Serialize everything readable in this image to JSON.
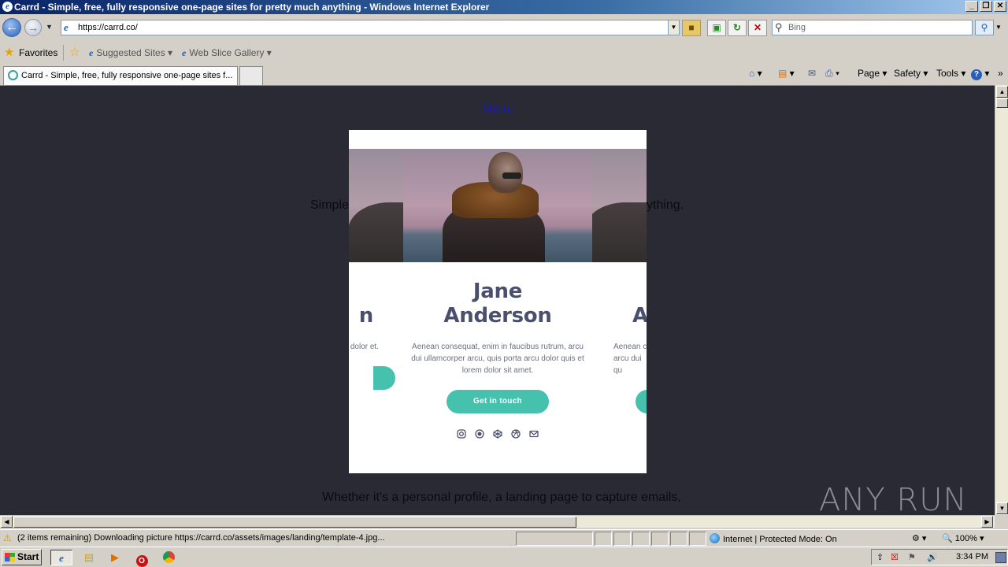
{
  "window": {
    "title": "Carrd - Simple, free, fully responsive one-page sites for pretty much anything - Windows Internet Explorer",
    "controls": [
      "_",
      "❐",
      "✕"
    ]
  },
  "nav": {
    "url": "https://carrd.co/",
    "search_placeholder": "Bing"
  },
  "favorites": {
    "label": "Favorites",
    "links": [
      "Suggested Sites ▾",
      "Web Slice Gallery ▾"
    ]
  },
  "tab": {
    "title": "Carrd - Simple, free, fully responsive one-page sites f..."
  },
  "commands": {
    "page": "Page ▾",
    "safety": "Safety ▾",
    "tools": "Tools ▾"
  },
  "page": {
    "menu_link": "Menu",
    "tagline_left": "Simple",
    "tagline_right": "ything.",
    "footer_line": "Whether it's a personal profile, a landing page to capture emails,"
  },
  "card": {
    "name_line1": "Jane",
    "name_line2": "Anderson",
    "bio": "Aenean consequat, enim in faucibus rutrum, arcu dui ullamcorper arcu, quis porta arcu dolor quis et lorem dolor sit amet.",
    "cta": "Get in touch",
    "left_name_fragment": "n",
    "left_bio_fragment": "us rutrum, a arcu dolor et.",
    "right_name_fragment": "A",
    "right_bio_fragment": "Aenean c arcu dui qu"
  },
  "status": {
    "text": "(2 items remaining) Downloading picture https://carrd.co/assets/images/landing/template-4.jpg...",
    "zone": "Internet | Protected Mode: On",
    "zoom": "100%"
  },
  "taskbar": {
    "start": "Start",
    "clock": "3:34 PM"
  },
  "watermark": "ANY RUN"
}
